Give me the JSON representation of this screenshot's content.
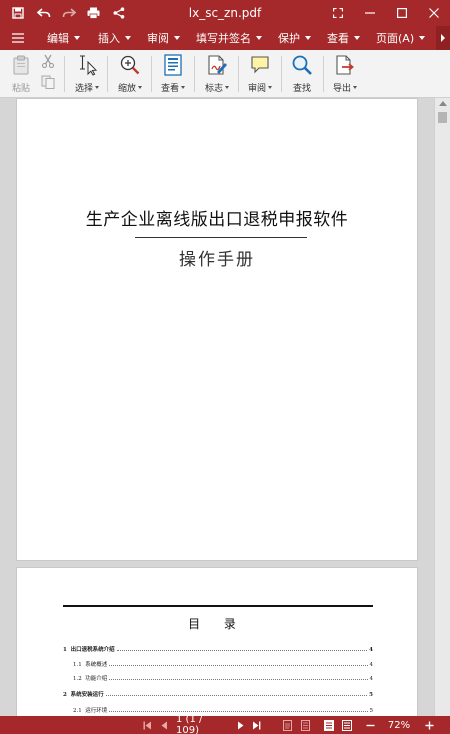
{
  "window": {
    "title": "lx_sc_zn.pdf"
  },
  "menu": {
    "items": [
      {
        "label": "编辑"
      },
      {
        "label": "插入"
      },
      {
        "label": "审阅"
      },
      {
        "label": "填写并签名"
      },
      {
        "label": "保护"
      },
      {
        "label": "查看"
      },
      {
        "label": "页面(A)"
      }
    ]
  },
  "toolbar": {
    "paste": "粘贴",
    "select": "选择",
    "zoom": "缩放",
    "view": "查看",
    "mark": "标志",
    "review": "审阅",
    "find": "查找",
    "export": "导出"
  },
  "document": {
    "title": "生产企业离线版出口退税申报软件",
    "subtitle": "操作手册",
    "toc": {
      "title": "目 录",
      "entries": [
        {
          "num": "1",
          "text": "出口退税系统介绍",
          "page": "4",
          "level": 1
        },
        {
          "num": "1.1",
          "text": "系统概述",
          "page": "4",
          "level": 2
        },
        {
          "num": "1.2",
          "text": "功能介绍",
          "page": "4",
          "level": 2
        },
        {
          "num": "2",
          "text": "系统安装运行",
          "page": "5",
          "level": 1
        },
        {
          "num": "2.1",
          "text": "运行环境",
          "page": "5",
          "level": 2
        }
      ]
    }
  },
  "status": {
    "page_indicator": "1 (1 / 109)",
    "zoom": "72%"
  },
  "colors": {
    "brand": "#a5292a",
    "toolbar_bg": "#f3f3f3",
    "icon_blue": "#1e6fb5",
    "icon_red": "#c0392b"
  }
}
